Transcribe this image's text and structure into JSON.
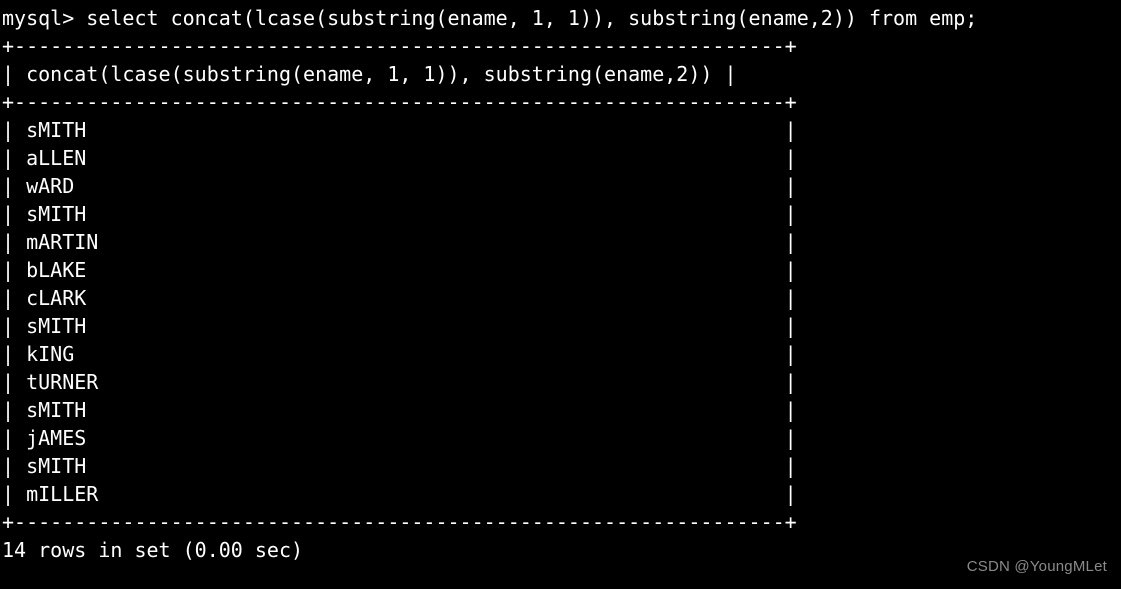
{
  "terminal": {
    "prompt": "mysql>",
    "query": " select concat(lcase(substring(ename, 1, 1)), substring(ename,2)) from emp;",
    "prompt_line": "mysql> select concat(lcase(substring(ename, 1, 1)), substring(ename,2)) from emp;",
    "separator": "+----------------------------------------------------------------+",
    "header_row": "| concat(lcase(substring(ename, 1, 1)), substring(ename,2)) |",
    "column_header": "concat(lcase(substring(ename, 1, 1)), substring(ename,2))",
    "rows": [
      "sMITH",
      "aLLEN",
      "wARD",
      "sMITH",
      "mARTIN",
      "bLAKE",
      "cLARK",
      "sMITH",
      "kING",
      "tURNER",
      "sMITH",
      "jAMES",
      "sMITH",
      "mILLER"
    ],
    "row_lines": [
      "| sMITH                                                          |",
      "| aLLEN                                                          |",
      "| wARD                                                           |",
      "| sMITH                                                          |",
      "| mARTIN                                                         |",
      "| bLAKE                                                          |",
      "| cLARK                                                          |",
      "| sMITH                                                          |",
      "| kING                                                           |",
      "| tURNER                                                         |",
      "| sMITH                                                          |",
      "| jAMES                                                          |",
      "| sMITH                                                          |",
      "| mILLER                                                         |"
    ],
    "status": "14 rows in set (0.00 sec)",
    "row_count": 14,
    "elapsed": "0.00 sec",
    "colors": {
      "background": "#000000",
      "foreground": "#ffffff",
      "watermark": "#8a8a8a"
    }
  },
  "watermark": {
    "text": "CSDN @YoungMLet"
  }
}
